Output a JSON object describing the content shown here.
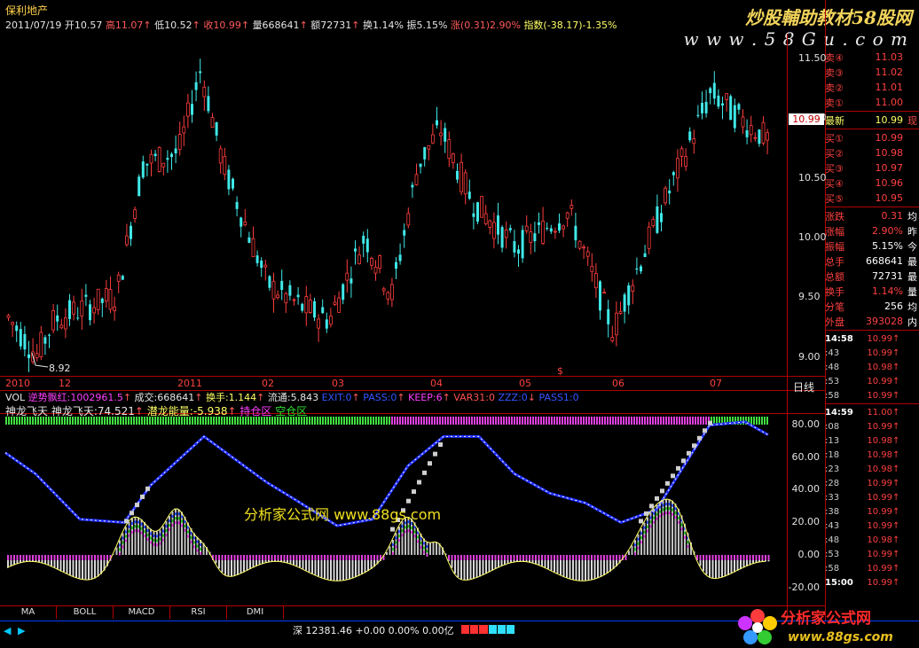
{
  "stock_name": "保利地产",
  "watermark1": "炒股輔助教材58股网",
  "watermark2": "w w w . 5 8 G u . c o m",
  "infobar": {
    "date": "2011/07/19",
    "open": "开10.57",
    "high": "高11.07",
    "low": "低10.52",
    "close": "收10.99",
    "volume": "量668641",
    "amount": "额72731",
    "turnover": "换1.14%",
    "amplitude": "振5.15%",
    "change": "涨(0.31)2.90%",
    "index": "指数(-38.17)-1.35%"
  },
  "price_axis": [
    "11.50",
    "11.00",
    "10.50",
    "10.00",
    "9.50",
    "9.00"
  ],
  "current_price_tag": "10.99",
  "low_marker": "8.92",
  "x_axis": [
    "2010",
    "12",
    "2011",
    "02",
    "03",
    "04",
    "05",
    "06",
    "07"
  ],
  "x_marker": "$",
  "period_label": "日线",
  "vol_bar": {
    "vol": "VOL",
    "t1": "逆势飘红:1002961.5",
    "t2": "成交:668641",
    "t3": "换手:1.144",
    "t4": "流通:5.843",
    "t5": "EXIT:0",
    "t6": "PASS:0",
    "t7": "KEEP:6",
    "t8": "VAR31:0",
    "t9": "ZZZ:0",
    "t10": "PASS1:0"
  },
  "ind_bar": {
    "name": "神龙飞天",
    "v1": "神龙飞天:74.521",
    "v2": "潜龙能量:-5.938",
    "v3": "持仓区",
    "v4": "空仓区"
  },
  "sub_axis": [
    "80.00",
    "60.00",
    "40.00",
    "20.00",
    "0.00",
    "-20.00"
  ],
  "analysis_text": "分析家公式网  www.88gs.com",
  "tabs": [
    "MA",
    "BOLL",
    "MACD",
    "RSI",
    "DMI"
  ],
  "status_index": "深  12381.46  +0.00  0.00%  0.00亿",
  "panel": {
    "sell": [
      {
        "label": "卖④",
        "value": "11.03"
      },
      {
        "label": "卖③",
        "value": "11.02"
      },
      {
        "label": "卖②",
        "value": "11.01"
      },
      {
        "label": "卖①",
        "value": "11.00"
      }
    ],
    "last": {
      "label": "最新",
      "value": "10.99",
      "ext": "现"
    },
    "buy": [
      {
        "label": "买①",
        "value": "10.99"
      },
      {
        "label": "买②",
        "value": "10.98"
      },
      {
        "label": "买③",
        "value": "10.97"
      },
      {
        "label": "买④",
        "value": "10.96"
      },
      {
        "label": "买⑤",
        "value": "10.95"
      }
    ],
    "stats": [
      {
        "label": "涨跌",
        "value": "0.31",
        "ext": "均"
      },
      {
        "label": "涨幅",
        "value": "2.90%",
        "ext": "昨"
      },
      {
        "label": "振幅",
        "value": "5.15%",
        "ext": "今"
      },
      {
        "label": "总手",
        "value": "668641",
        "ext": "最"
      },
      {
        "label": "总额",
        "value": "72731",
        "ext": "最"
      },
      {
        "label": "换手",
        "value": "1.14%",
        "ext": "量"
      },
      {
        "label": "分笔",
        "value": "256",
        "ext": "均"
      },
      {
        "label": "外盘",
        "value": "393028",
        "ext": "内"
      }
    ],
    "ticks1": [
      {
        "t": "14:58",
        "v": "10.99"
      },
      {
        "t": ":43",
        "v": "10.99"
      },
      {
        "t": ":48",
        "v": "10.98"
      },
      {
        "t": ":53",
        "v": "10.99"
      },
      {
        "t": ":58",
        "v": "10.99"
      }
    ],
    "ticks2": [
      {
        "t": "14:59",
        "v": "11.00"
      },
      {
        "t": ":08",
        "v": "10.99"
      },
      {
        "t": ":13",
        "v": "10.98"
      },
      {
        "t": ":18",
        "v": "10.98"
      },
      {
        "t": ":23",
        "v": "10.98"
      },
      {
        "t": ":28",
        "v": "10.99"
      },
      {
        "t": ":33",
        "v": "10.99"
      },
      {
        "t": ":38",
        "v": "10.99"
      },
      {
        "t": ":43",
        "v": "10.99"
      },
      {
        "t": ":48",
        "v": "10.98"
      },
      {
        "t": ":53",
        "v": "10.99"
      },
      {
        "t": ":58",
        "v": "10.99"
      },
      {
        "t": "15:00",
        "v": "10.99"
      }
    ]
  },
  "logo_text": "分析家公式网",
  "logo_url": "www.88gs.com"
}
